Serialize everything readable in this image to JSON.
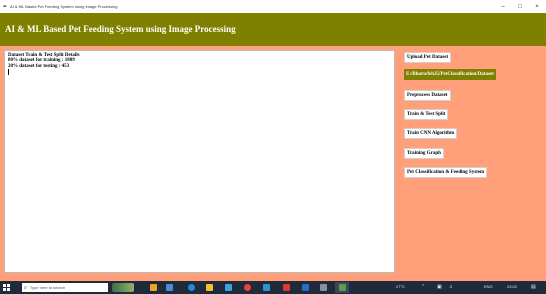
{
  "window": {
    "title": "AI & ML Based Pet Feeding System using Image Processing",
    "minimize": "–",
    "maximize": "□",
    "close": "×"
  },
  "header": {
    "title": "AI & ML Based Pet Feeding System using Image Processing"
  },
  "output": {
    "lines": [
      "Dataset Train & Test Split Details",
      "80% dataset for training : 1809",
      "20% dataset for testing  : 453"
    ]
  },
  "buttons": {
    "upload": "Upload Pet Dataset",
    "preprocess": "Preprocess Dataset",
    "split": "Train & Test Split",
    "train_cnn": "Train CNN Algorithm",
    "graph": "Training Graph",
    "classify": "Pet Classification & Feeding System"
  },
  "path_label": "E:/Bharu/feb25/PetClassification/Dataset",
  "taskbar": {
    "search_placeholder": "Type here to search",
    "weather": "27°C",
    "language": "ENG",
    "time": "23:02"
  },
  "colors": {
    "background": "#ffa07a",
    "header": "#808000",
    "path_label_bg": "#808000",
    "taskbar": "#1f2a3a"
  }
}
